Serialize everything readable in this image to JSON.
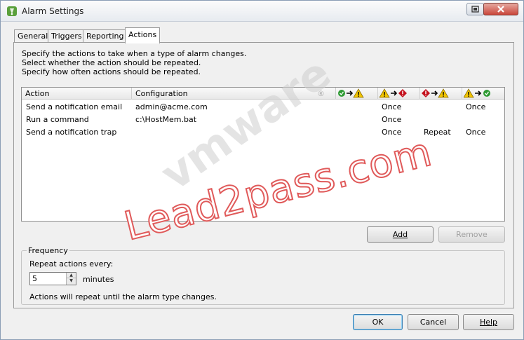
{
  "window": {
    "title": "Alarm Settings"
  },
  "tabs": [
    {
      "label": "General"
    },
    {
      "label": "Triggers"
    },
    {
      "label": "Reporting"
    },
    {
      "label": "Actions",
      "active": true
    }
  ],
  "description": [
    "Specify the actions to take when a type of alarm changes.",
    "Select whether the action should be repeated.",
    "Specify how often actions should be repeated."
  ],
  "table": {
    "columns": {
      "action": "Action",
      "configuration": "Configuration",
      "transitions": [
        {
          "from": "green-ok-icon",
          "to": "yellow-warning-icon"
        },
        {
          "from": "yellow-warning-icon",
          "to": "red-alert-icon"
        },
        {
          "from": "red-alert-icon",
          "to": "yellow-warning-icon"
        },
        {
          "from": "yellow-warning-icon",
          "to": "green-ok-icon"
        }
      ]
    },
    "rows": [
      {
        "action": "Send a notification email",
        "configuration": "admin@acme.com",
        "t1": "",
        "t2": "Once",
        "t3": "",
        "t4": "Once"
      },
      {
        "action": "Run a command",
        "configuration": "c:\\HostMem.bat",
        "t1": "",
        "t2": "Once",
        "t3": "",
        "t4": ""
      },
      {
        "action": "Send a notification trap",
        "configuration": "",
        "t1": "",
        "t2": "Once",
        "t3": "Repeat",
        "t4": "Once"
      }
    ]
  },
  "buttons": {
    "add": "Add",
    "remove": "Remove",
    "ok": "OK",
    "cancel": "Cancel",
    "help": "Help"
  },
  "frequency": {
    "legend": "Frequency",
    "repeat_label": "Repeat actions every:",
    "value": "5",
    "unit": "minutes",
    "note": "Actions will repeat until the alarm type changes."
  },
  "watermarks": {
    "brand": "vmware",
    "site": "Lead2pass.com"
  },
  "colors": {
    "ok": "#2e9b33",
    "warning": "#f2c500",
    "alert": "#c4121e",
    "watermark": "#e05a5a"
  }
}
